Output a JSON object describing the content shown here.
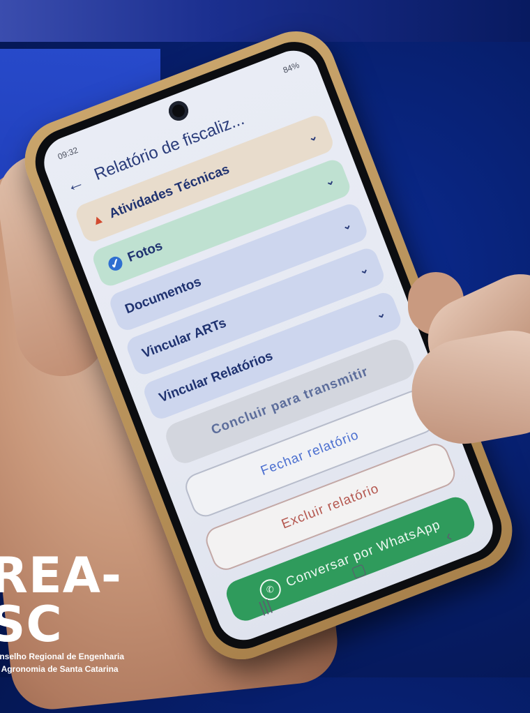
{
  "phone": {
    "status_time": "09:32",
    "status_battery": "84%"
  },
  "app": {
    "title": "Relatório de fiscaliz...",
    "sections": [
      {
        "label": "Atividades Técnicas",
        "state": "warning"
      },
      {
        "label": "Fotos",
        "state": "done"
      },
      {
        "label": "Documentos",
        "state": "none"
      },
      {
        "label": "Vincular ARTs",
        "state": "none"
      },
      {
        "label": "Vincular Relatórios",
        "state": "none"
      }
    ],
    "buttons": {
      "concluir": "Concluir para transmitir",
      "fechar": "Fechar relatório",
      "excluir": "Excluir relatório",
      "whatsapp": "Conversar por WhatsApp"
    }
  },
  "logo": {
    "mark": "REA-SC",
    "line1": "onselho Regional de Engenharia",
    "line2": "e Agronomia de Santa Catarina"
  },
  "colors": {
    "background": "#071f6e",
    "warning_section": "#e8dccc",
    "done_section": "#bfe1d1",
    "default_section": "#cdd6ee",
    "whatsapp_button": "#2f9b5c"
  }
}
